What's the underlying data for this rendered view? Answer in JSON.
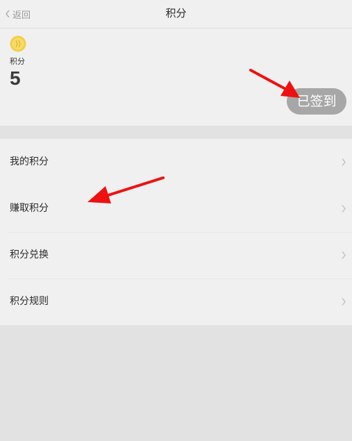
{
  "navbar": {
    "back_label": "返回",
    "title": "积分"
  },
  "points": {
    "label": "积分",
    "value": "5",
    "coin_icon": "coin-icon",
    "coin_color": "#f3cf45"
  },
  "sign_in": {
    "label": "已签到",
    "bg_color": "#a7a7a7"
  },
  "menu": {
    "items": [
      {
        "label": "我的积分"
      },
      {
        "label": "赚取积分"
      },
      {
        "label": "积分兑换"
      },
      {
        "label": "积分规则"
      }
    ]
  },
  "annotations": {
    "arrow_color": "#ee1111"
  }
}
